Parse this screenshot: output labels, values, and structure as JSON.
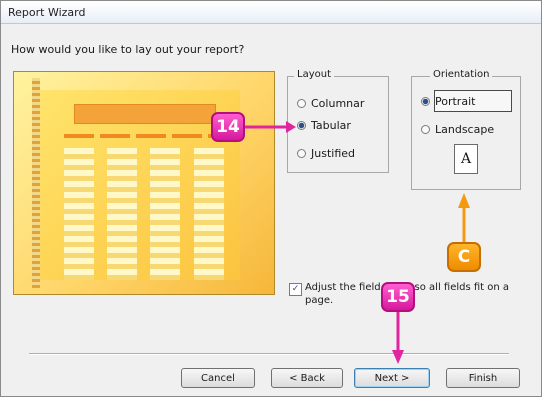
{
  "window": {
    "title": "Report Wizard"
  },
  "question": "How would you like to lay out your report?",
  "layout": {
    "legend": "Layout",
    "options": [
      "Columnar",
      "Tabular",
      "Justified"
    ],
    "selected": "Tabular"
  },
  "orientation": {
    "legend": "Orientation",
    "options": [
      "Portrait",
      "Landscape"
    ],
    "selected": "Portrait",
    "icon_letter": "A"
  },
  "adjust": {
    "checked": true,
    "label": "Adjust the field width so all fields fit on a page."
  },
  "buttons": {
    "cancel": "Cancel",
    "back": "< Back",
    "next": "Next >",
    "finish": "Finish"
  },
  "callouts": {
    "step14": "14",
    "step15": "15",
    "stepC": "C"
  },
  "colors": {
    "callout_pink": "#e0259f",
    "callout_orange": "#f39a12",
    "preview_yellow": "#ffd66a"
  }
}
